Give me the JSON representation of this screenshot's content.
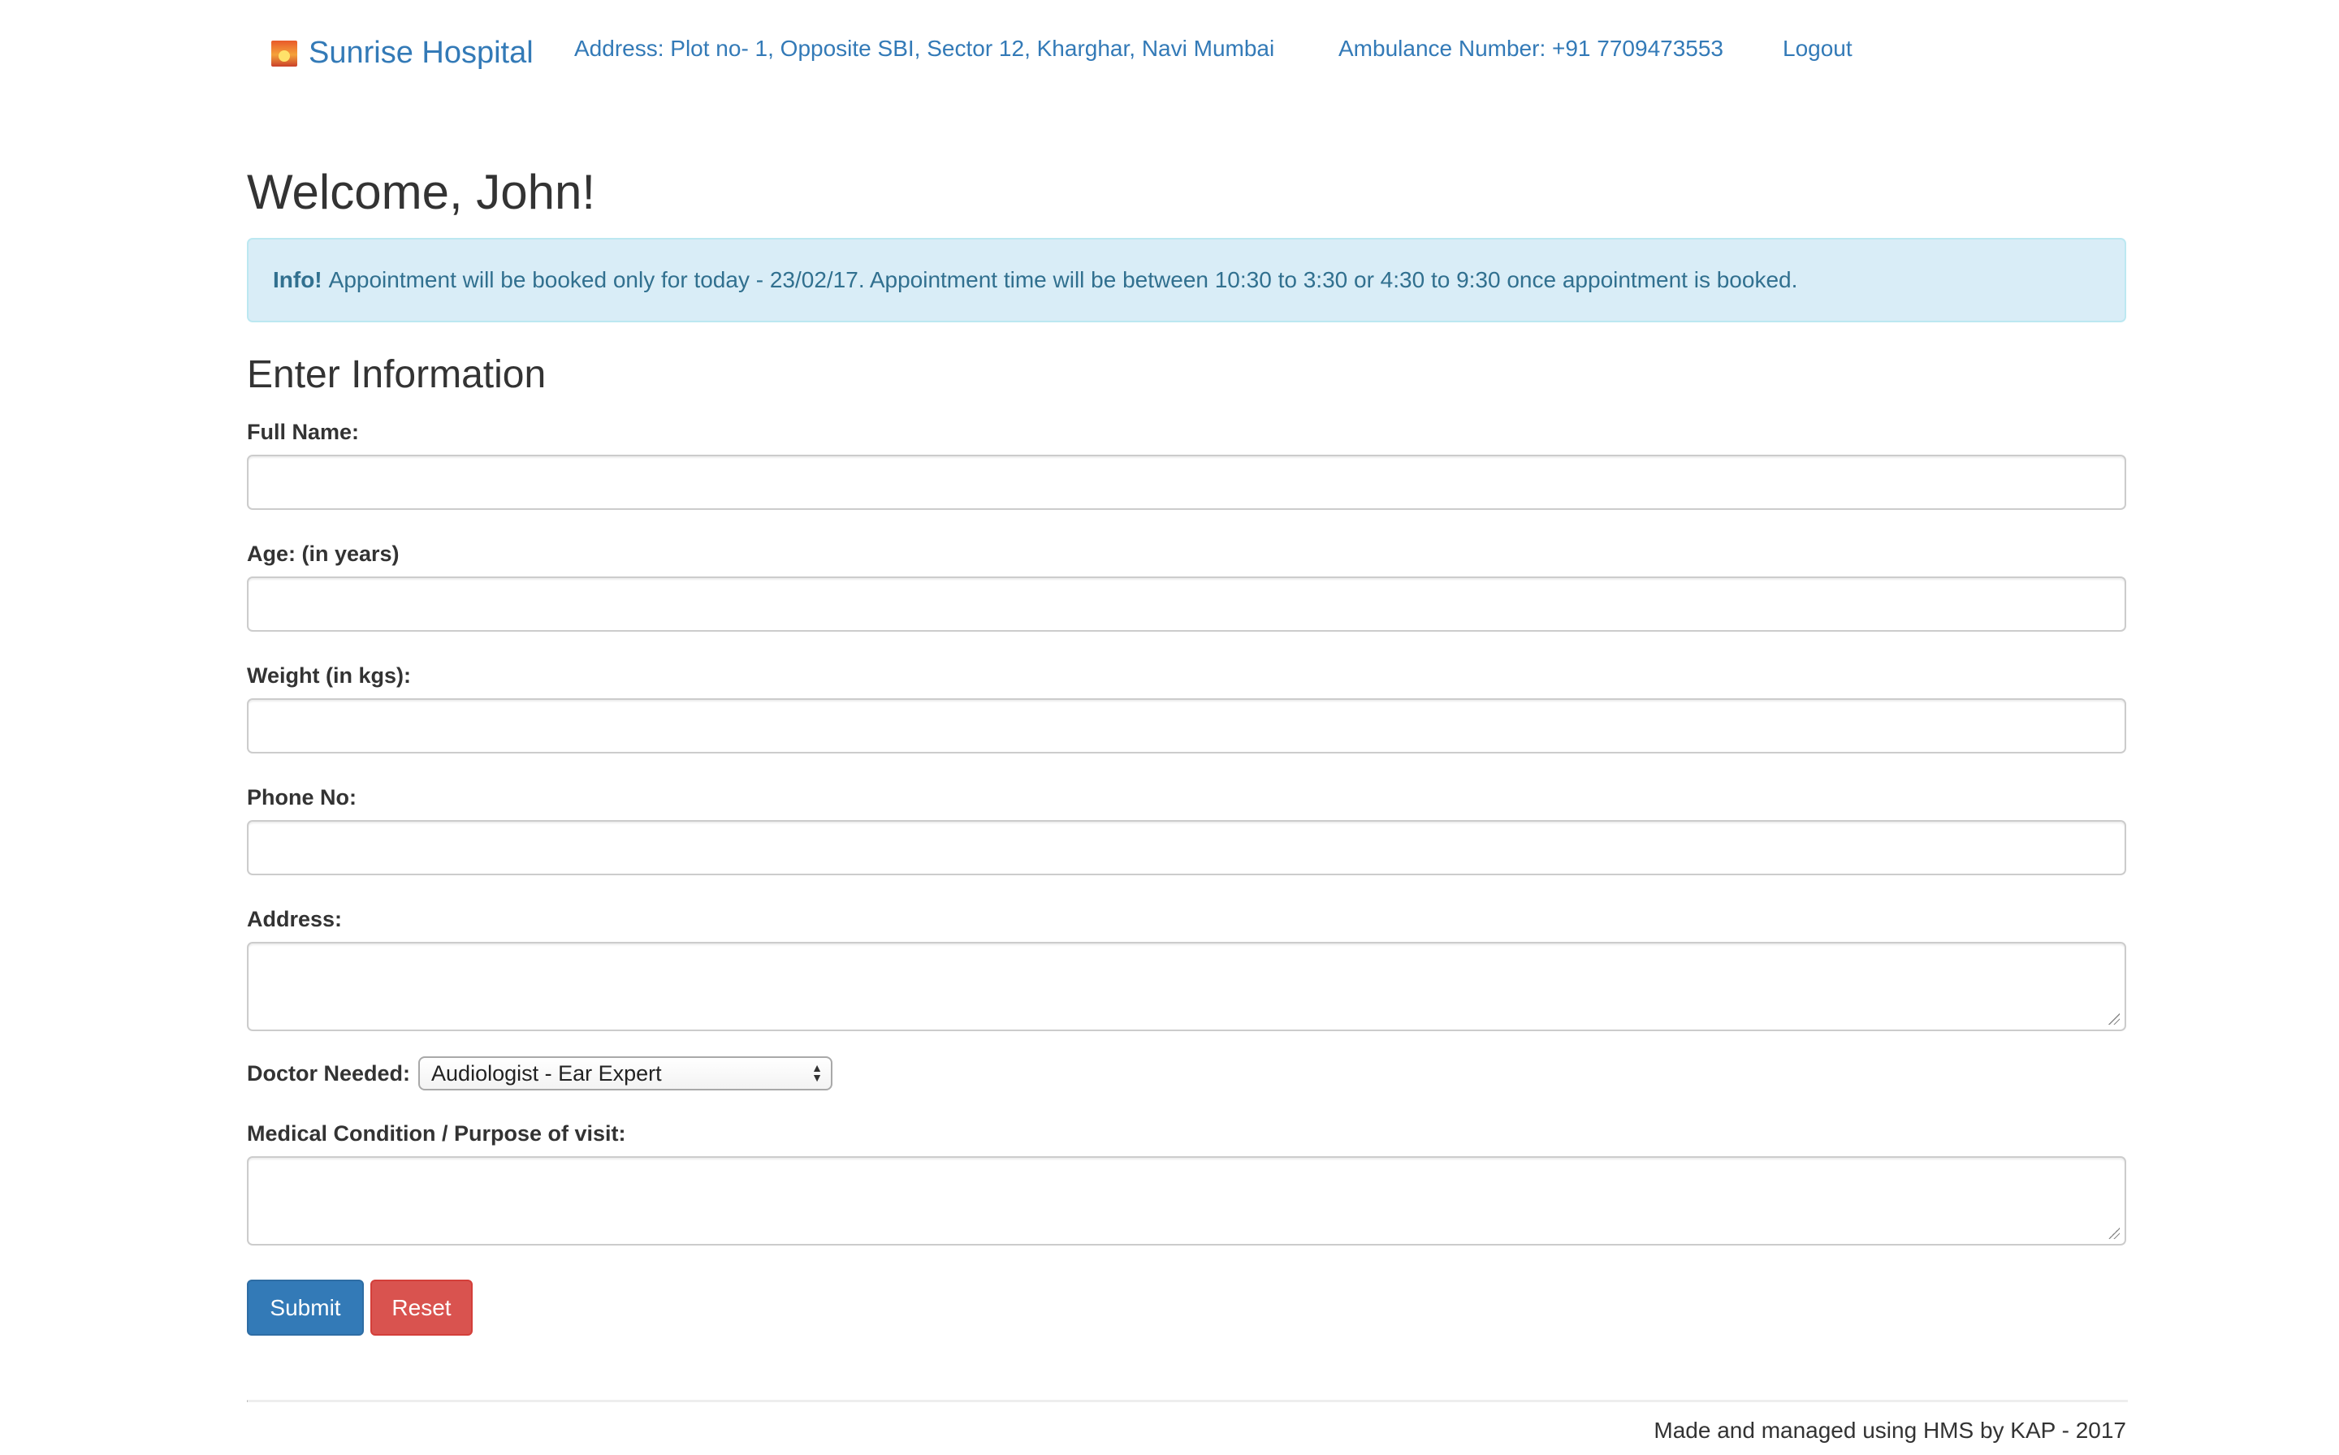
{
  "navbar": {
    "brand": "Sunrise Hospital",
    "address": "Address: Plot no- 1, Opposite SBI, Sector 12, Kharghar, Navi Mumbai",
    "ambulance": "Ambulance Number: +91 7709473553",
    "logout": "Logout"
  },
  "page": {
    "welcome": "Welcome, John!",
    "alert_strong": "Info!",
    "alert_text": "Appointment will be booked only for today - 23/02/17. Appointment time will be between 10:30 to 3:30 or 4:30 to 9:30 once appointment is booked.",
    "section_title": "Enter Information"
  },
  "form": {
    "full_name": {
      "label": "Full Name:",
      "value": ""
    },
    "age": {
      "label": "Age: (in years)",
      "value": ""
    },
    "weight": {
      "label": "Weight (in kgs):",
      "value": ""
    },
    "phone": {
      "label": "Phone No:",
      "value": ""
    },
    "address": {
      "label": "Address:",
      "value": ""
    },
    "doctor": {
      "label": "Doctor Needed:",
      "selected": "Audiologist - Ear Expert"
    },
    "condition": {
      "label": "Medical Condition / Purpose of visit:",
      "value": ""
    },
    "submit_label": "Submit",
    "reset_label": "Reset"
  },
  "footer": {
    "text": "Made and managed using HMS by KAP - 2017"
  },
  "colors": {
    "link": "#337ab7",
    "info_bg": "#d9edf7",
    "info_text": "#31708f",
    "primary": "#337ab7",
    "danger": "#d9534f"
  },
  "icons": {
    "brand": "sunrise-logo-icon",
    "select": "select-arrows-icon",
    "resize": "resize-grip-icon"
  }
}
